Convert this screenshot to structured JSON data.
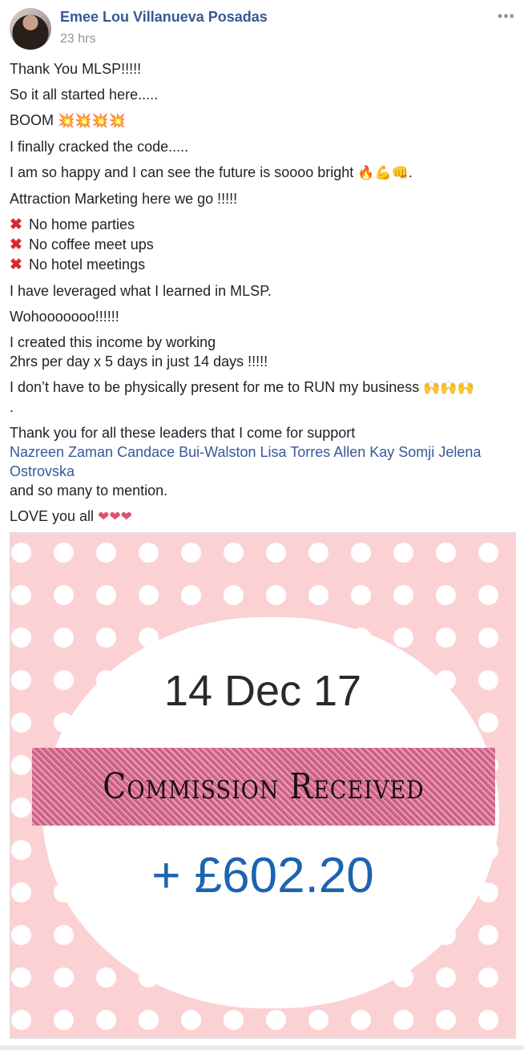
{
  "post": {
    "author": "Emee Lou Villanueva Posadas",
    "timestamp": "23 hrs",
    "more_icon": "more-options-icon",
    "lines": {
      "l1": "Thank You MLSP!!!!!",
      "l2": "So it all started here.....",
      "l3": "BOOM",
      "l3_emoji": "💥💥💥💥",
      "l4": "I finally cracked the code.....",
      "l5": "I am so happy and I can see the future is soooo bright",
      "l5_emoji": "🔥💪👊",
      "l5_end": ".",
      "l6": "Attraction Marketing here we go !!!!!",
      "l7a": "No home parties",
      "l7b": "No coffee meet ups",
      "l7c": "No hotel meetings",
      "x_mark": "✖",
      "l8": "I have leveraged what I learned in MLSP.",
      "l9": "Wohooooooo!!!!!!",
      "l10a": "I created this income by working",
      "l10b": "2hrs per day x 5 days in just 14 days !!!!!",
      "l11": "I don’t have to be physically present for me to RUN my business",
      "l11_emoji": "🙌🙌🙌",
      "l11_end": ".",
      "l12": "Thank you for all these leaders that I come for support",
      "mentions": [
        "Nazreen Zaman",
        "Candace Bui-Walston",
        "Lisa Torres",
        "Allen Kay Somji",
        "Jelena",
        "Ostrovska"
      ],
      "l13": "and so many to mention.",
      "l14": "LOVE you all",
      "l14_emoji": "❤❤❤"
    },
    "photo": {
      "date": "14 Dec 17",
      "banner": "Commission Received",
      "amount": "+ £602.20",
      "colors": {
        "background": "#fbd1d3",
        "amount": "#1c63b0",
        "banner": "#d36c8d"
      }
    }
  }
}
